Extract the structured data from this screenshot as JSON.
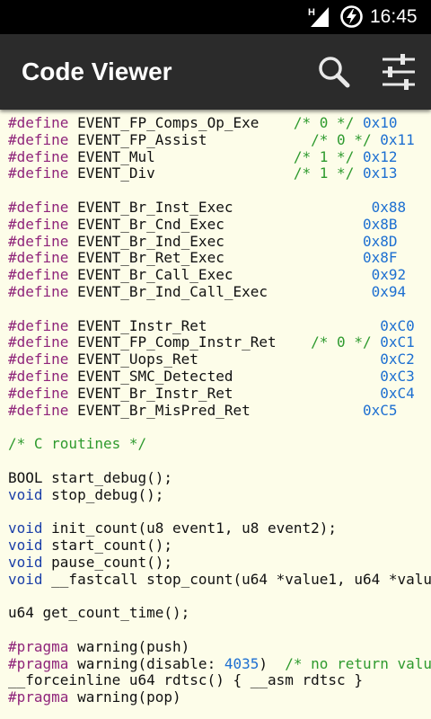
{
  "status_bar": {
    "network": "H",
    "time": "16:45"
  },
  "app_bar": {
    "title": "Code Viewer",
    "icons": [
      "search-icon",
      "settings-sliders-icon"
    ]
  },
  "colors": {
    "background": "#fdfde9",
    "app_bar": "#2b2b2b",
    "keyword": "#1b3fa8",
    "preprocessor": "#8f247a",
    "comment": "#2e9a2e",
    "number": "#1d6fd1"
  },
  "code_lines": [
    [
      [
        "pp",
        "#define"
      ],
      [
        "t",
        " EVENT_FP_Comps_Op_Exe    "
      ],
      [
        "cm",
        "/* 0 */"
      ],
      [
        "t",
        " "
      ],
      [
        "nm",
        "0x10"
      ]
    ],
    [
      [
        "pp",
        "#define"
      ],
      [
        "t",
        " EVENT_FP_Assist            "
      ],
      [
        "cm",
        "/* 0 */"
      ],
      [
        "t",
        " "
      ],
      [
        "nm",
        "0x11"
      ]
    ],
    [
      [
        "pp",
        "#define"
      ],
      [
        "t",
        " EVENT_Mul                "
      ],
      [
        "cm",
        "/* 1 */"
      ],
      [
        "t",
        " "
      ],
      [
        "nm",
        "0x12"
      ]
    ],
    [
      [
        "pp",
        "#define"
      ],
      [
        "t",
        " EVENT_Div                "
      ],
      [
        "cm",
        "/* 1 */"
      ],
      [
        "t",
        " "
      ],
      [
        "nm",
        "0x13"
      ]
    ],
    [],
    [
      [
        "pp",
        "#define"
      ],
      [
        "t",
        " EVENT_Br_Inst_Exec                "
      ],
      [
        "nm",
        "0x88"
      ]
    ],
    [
      [
        "pp",
        "#define"
      ],
      [
        "t",
        " EVENT_Br_Cnd_Exec                "
      ],
      [
        "nm",
        "0x8B"
      ]
    ],
    [
      [
        "pp",
        "#define"
      ],
      [
        "t",
        " EVENT_Br_Ind_Exec                "
      ],
      [
        "nm",
        "0x8D"
      ]
    ],
    [
      [
        "pp",
        "#define"
      ],
      [
        "t",
        " EVENT_Br_Ret_Exec                "
      ],
      [
        "nm",
        "0x8F"
      ]
    ],
    [
      [
        "pp",
        "#define"
      ],
      [
        "t",
        " EVENT_Br_Call_Exec                "
      ],
      [
        "nm",
        "0x92"
      ]
    ],
    [
      [
        "pp",
        "#define"
      ],
      [
        "t",
        " EVENT_Br_Ind_Call_Exec            "
      ],
      [
        "nm",
        "0x94"
      ]
    ],
    [],
    [
      [
        "pp",
        "#define"
      ],
      [
        "t",
        " EVENT_Instr_Ret                    "
      ],
      [
        "nm",
        "0xC0"
      ]
    ],
    [
      [
        "pp",
        "#define"
      ],
      [
        "t",
        " EVENT_FP_Comp_Instr_Ret    "
      ],
      [
        "cm",
        "/* 0 */"
      ],
      [
        "t",
        " "
      ],
      [
        "nm",
        "0xC1"
      ]
    ],
    [
      [
        "pp",
        "#define"
      ],
      [
        "t",
        " EVENT_Uops_Ret                     "
      ],
      [
        "nm",
        "0xC2"
      ]
    ],
    [
      [
        "pp",
        "#define"
      ],
      [
        "t",
        " EVENT_SMC_Detected                 "
      ],
      [
        "nm",
        "0xC3"
      ]
    ],
    [
      [
        "pp",
        "#define"
      ],
      [
        "t",
        " EVENT_Br_Instr_Ret                 "
      ],
      [
        "nm",
        "0xC4"
      ]
    ],
    [
      [
        "pp",
        "#define"
      ],
      [
        "t",
        " EVENT_Br_MisPred_Ret             "
      ],
      [
        "nm",
        "0xC5"
      ]
    ],
    [],
    [
      [
        "cm",
        "/* C routines */"
      ]
    ],
    [],
    [
      [
        "t",
        "BOOL start_debug();"
      ]
    ],
    [
      [
        "kw",
        "void"
      ],
      [
        "t",
        " stop_debug();"
      ]
    ],
    [],
    [
      [
        "kw",
        "void"
      ],
      [
        "t",
        " init_count(u8 event1, u8 event2);"
      ]
    ],
    [
      [
        "kw",
        "void"
      ],
      [
        "t",
        " start_count();"
      ]
    ],
    [
      [
        "kw",
        "void"
      ],
      [
        "t",
        " pause_count();"
      ]
    ],
    [
      [
        "kw",
        "void"
      ],
      [
        "t",
        " __fastcall stop_count(u64 *value1, u64 *valu"
      ]
    ],
    [],
    [
      [
        "t",
        "u64 get_count_time();"
      ]
    ],
    [],
    [
      [
        "pp",
        "#pragma"
      ],
      [
        "t",
        " warning(push)"
      ]
    ],
    [
      [
        "pp",
        "#pragma"
      ],
      [
        "t",
        " warning(disable: "
      ],
      [
        "nm",
        "4035"
      ],
      [
        "t",
        ")  "
      ],
      [
        "cm",
        "/* no return valu"
      ]
    ],
    [
      [
        "t",
        "__forceinline u64 rdtsc() { __asm rdtsc }"
      ]
    ],
    [
      [
        "pp",
        "#pragma"
      ],
      [
        "t",
        " warning(pop)"
      ]
    ]
  ]
}
